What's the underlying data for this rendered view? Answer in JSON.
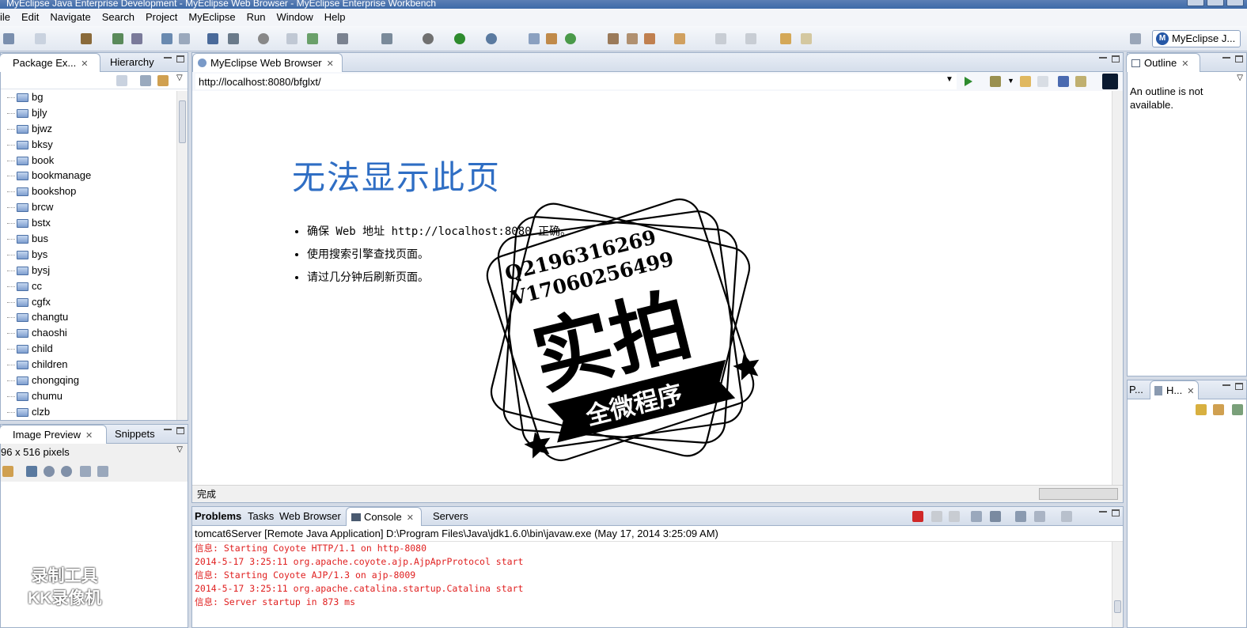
{
  "window": {
    "title": "MyEclipse Java Enterprise Development - MyEclipse Web Browser - MyEclipse Enterprise Workbench"
  },
  "menu": [
    "ile",
    "Edit",
    "Navigate",
    "Search",
    "Project",
    "MyEclipse",
    "Run",
    "Window",
    "Help"
  ],
  "perspective": {
    "icon_letter": "M",
    "label": "MyEclipse J..."
  },
  "left_panel": {
    "tabs": [
      "Package Ex...",
      "Hierarchy"
    ],
    "items": [
      "bg",
      "bjly",
      "bjwz",
      "bksy",
      "book",
      "bookmanage",
      "bookshop",
      "brcw",
      "bstx",
      "bus",
      "bys",
      "bysj",
      "cc",
      "cgfx",
      "changtu",
      "chaoshi",
      "child",
      "children",
      "chongqing",
      "chumu",
      "clzb"
    ]
  },
  "image_preview": {
    "tabs": [
      "Image Preview",
      "Snippets"
    ],
    "size_text": "96 x 516 pixels",
    "watermark_lines": [
      "录制工具",
      "KK录像机"
    ]
  },
  "browser": {
    "tab": "MyEclipse Web Browser",
    "url": "http://localhost:8080/bfglxt/",
    "error_title": "无法显示此页",
    "bullets": [
      "确保 Web 地址 http://localhost:8080 正确。",
      "使用搜索引擎查找页面。",
      "请过几分钟后刷新页面。"
    ],
    "status": "完成"
  },
  "stamp": {
    "line1": "Q2196316269",
    "line2": "V17060256499",
    "main": "实拍",
    "ribbon": "全微程序"
  },
  "console": {
    "tabs": [
      "Problems",
      "Tasks",
      "Web Browser",
      "Console",
      "Servers"
    ],
    "header": "tomcat6Server [Remote Java Application] D:\\Program Files\\Java\\jdk1.6.0\\bin\\javaw.exe (May 17, 2014 3:25:09 AM)",
    "lines": [
      "信息: Starting Coyote HTTP/1.1 on http-8080",
      "2014-5-17 3:25:11 org.apache.coyote.ajp.AjpAprProtocol start",
      "信息: Starting Coyote AJP/1.3 on ajp-8009",
      "2014-5-17 3:25:11 org.apache.catalina.startup.Catalina start",
      "信息: Server startup in 873 ms"
    ]
  },
  "outline": {
    "tab": "Outline",
    "message": "An outline is not available."
  },
  "right_bottom": {
    "tabs": [
      "P...",
      "H..."
    ]
  },
  "colors": {
    "accent": "#2f6ec4",
    "console_text": "#e02020",
    "run_green": "#2e8b2e"
  }
}
